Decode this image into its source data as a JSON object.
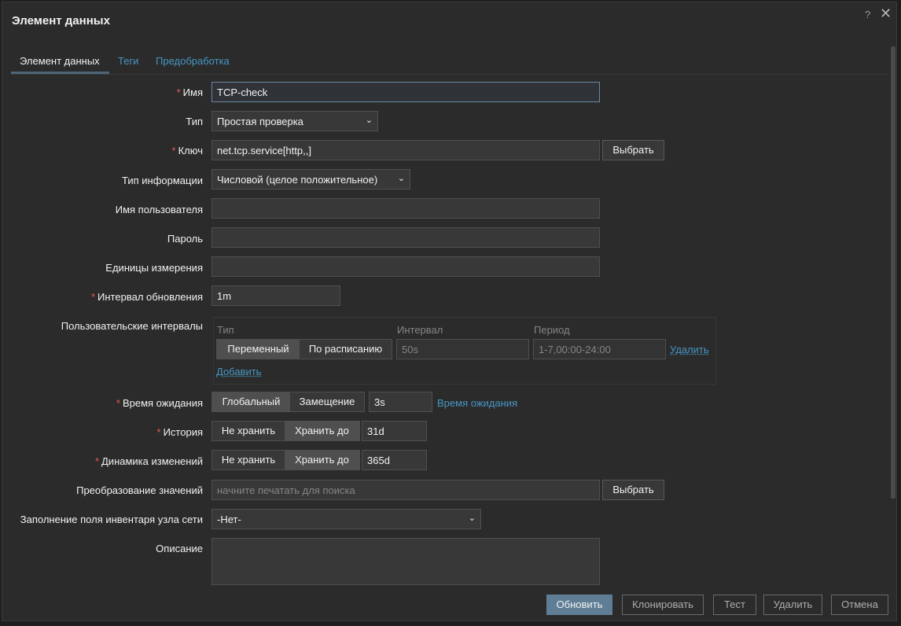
{
  "dialog": {
    "title": "Элемент данных",
    "help": "?",
    "close": "✕"
  },
  "tabs": [
    "Элемент данных",
    "Теги",
    "Предобработка"
  ],
  "form": {
    "name": {
      "label": "Имя",
      "value": "TCP-check"
    },
    "type": {
      "label": "Тип",
      "value": "Простая проверка"
    },
    "key": {
      "label": "Ключ",
      "value": "net.tcp.service[http,,]",
      "button": "Выбрать"
    },
    "info_type": {
      "label": "Тип информации",
      "value": "Числовой (целое положительное)"
    },
    "username": {
      "label": "Имя пользователя",
      "value": ""
    },
    "password": {
      "label": "Пароль",
      "value": ""
    },
    "units": {
      "label": "Единицы измерения",
      "value": ""
    },
    "interval": {
      "label": "Интервал обновления",
      "value": "1m"
    },
    "custom_intervals": {
      "label": "Пользовательские интервалы",
      "col_type": "Тип",
      "col_interval": "Интервал",
      "col_period": "Период",
      "seg_flexible": "Переменный",
      "seg_scheduling": "По расписанию",
      "interval_value": "50s",
      "period_value": "1-7,00:00-24:00",
      "remove": "Удалить",
      "add": "Добавить"
    },
    "timeout": {
      "label": "Время ожидания",
      "seg_global": "Глобальный",
      "seg_override": "Замещение",
      "value": "3s",
      "link": "Время ожидания"
    },
    "history": {
      "label": "История",
      "seg_no": "Не хранить",
      "seg_keep": "Хранить до",
      "value": "31d"
    },
    "trends": {
      "label": "Динамика изменений",
      "seg_no": "Не хранить",
      "seg_keep": "Хранить до",
      "value": "365d"
    },
    "valuemap": {
      "label": "Преобразование значений",
      "placeholder": "начните печатать для поиска",
      "button": "Выбрать"
    },
    "inventory": {
      "label": "Заполнение поля инвентаря узла сети",
      "value": "-Нет-"
    },
    "description": {
      "label": "Описание",
      "value": ""
    }
  },
  "footer": {
    "update": "Обновить",
    "clone": "Клонировать",
    "test": "Тест",
    "delete": "Удалить",
    "cancel": "Отмена"
  }
}
